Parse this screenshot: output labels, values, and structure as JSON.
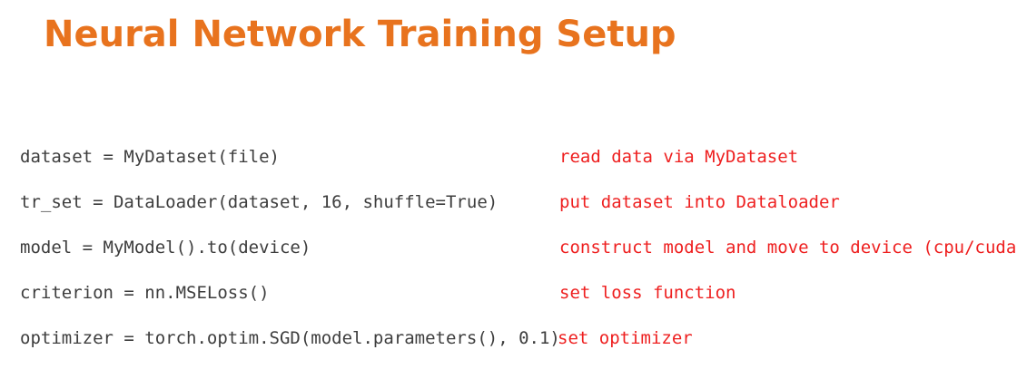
{
  "title": "Neural Network Training Setup",
  "colors": {
    "title": "#e8731e",
    "code": "#3d3d3d",
    "comment": "#ee1f1f"
  },
  "lines": [
    {
      "code": "dataset = MyDataset(file)",
      "comment": "read data via MyDataset"
    },
    {
      "code": "tr_set = DataLoader(dataset, 16, shuffle=True)",
      "comment": "put dataset into Dataloader"
    },
    {
      "code": "model = MyModel().to(device)",
      "comment": "construct model and move to device (cpu/cuda)"
    },
    {
      "code": "criterion = nn.MSELoss()",
      "comment": "set loss function"
    },
    {
      "code": "optimizer = torch.optim.SGD(model.parameters(), 0.1)",
      "comment": "set optimizer"
    }
  ]
}
